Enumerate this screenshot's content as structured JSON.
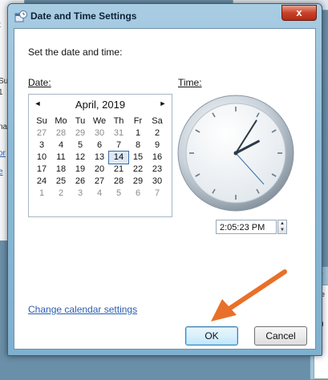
{
  "background": {
    "left_fragments": [
      "t",
      "Su",
      "1",
      "na",
      "or",
      "e"
    ],
    "right_fragments": [
      "T",
      "Se",
      "Ti",
      "(U",
      "✔"
    ]
  },
  "dialog": {
    "title": "Date and Time Settings",
    "close_label": "x",
    "instruction": "Set the date and time:",
    "date_label": "Date:",
    "time_label": "Time:",
    "calendar": {
      "month_year": "April, 2019",
      "prev_glyph": "◄",
      "next_glyph": "►",
      "weekdays": [
        "Su",
        "Mo",
        "Tu",
        "We",
        "Th",
        "Fr",
        "Sa"
      ],
      "days": [
        "27",
        "28",
        "29",
        "30",
        "31",
        "1",
        "2",
        "3",
        "4",
        "5",
        "6",
        "7",
        "8",
        "9",
        "10",
        "11",
        "12",
        "13",
        "14",
        "15",
        "16",
        "17",
        "18",
        "19",
        "20",
        "21",
        "22",
        "23",
        "24",
        "25",
        "26",
        "27",
        "28",
        "29",
        "30",
        "1",
        "2",
        "3",
        "4",
        "5",
        "6",
        "7"
      ],
      "selected_day": "14"
    },
    "clock": {
      "hour": 2,
      "minute": 5,
      "second": 23
    },
    "time_value": "2:05:23 PM",
    "change_calendar_link": "Change calendar settings",
    "ok_label": "OK",
    "cancel_label": "Cancel",
    "colors": {
      "accent_arrow": "#e8702a",
      "link": "#2a5db0"
    }
  }
}
